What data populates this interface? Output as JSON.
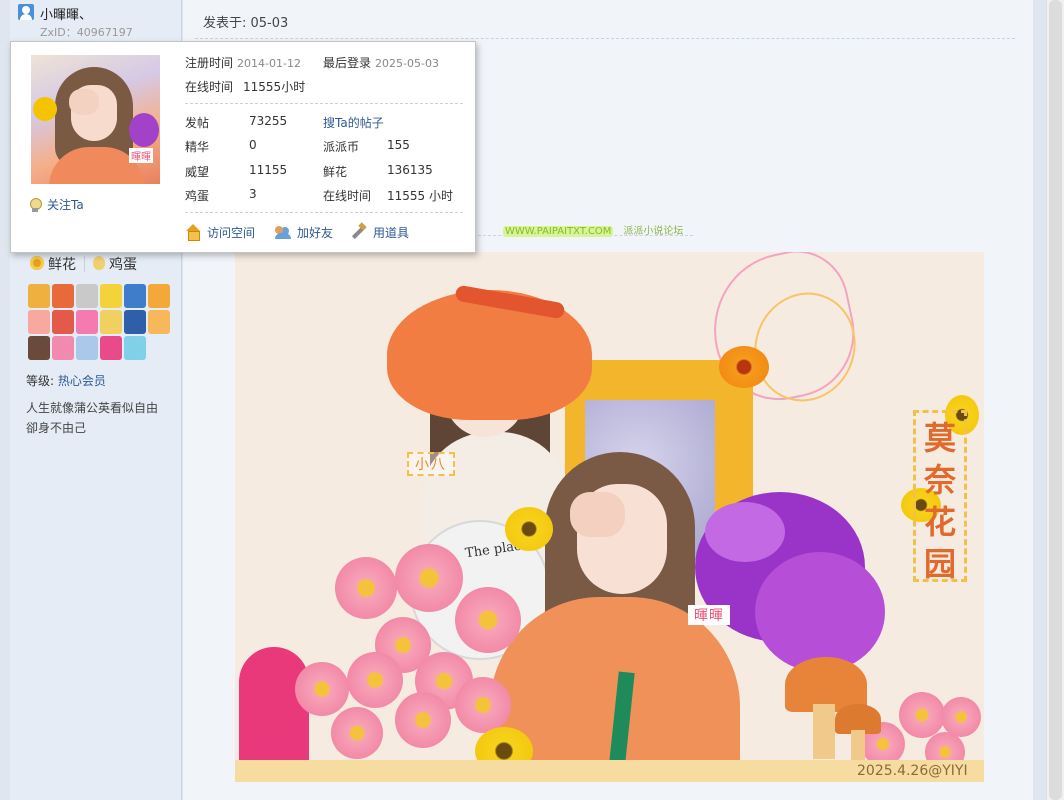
{
  "author": {
    "name": "小暉暉、",
    "zxid": "ZxID：40967197"
  },
  "post": {
    "date": "发表于: 05-03"
  },
  "card": {
    "follow_label": "关注Ta",
    "reg_label": "注册时间",
    "reg_value": "2014-01-12",
    "last_login_label": "最后登录",
    "last_login_value": "2025-05-03",
    "online_label": "在线时间",
    "online_value": "11555小时",
    "stats": {
      "posts_label": "发帖",
      "posts_value": "73255",
      "search_link": "搜Ta的帖子",
      "digest_label": "精华",
      "digest_value": "0",
      "coins_label": "派派币",
      "coins_value": "155",
      "prestige_label": "威望",
      "prestige_value": "11155",
      "flowers_label": "鲜花",
      "flowers_value": "136135",
      "eggs_label": "鸡蛋",
      "eggs_value": "3",
      "online_label": "在线时间",
      "online_value": "11555 小时"
    },
    "actions": {
      "visit": "访问空间",
      "add_friend": "加好友",
      "use_tool": "用道具"
    }
  },
  "sidebar": {
    "flower_label": "鲜花",
    "egg_label": "鸡蛋",
    "level_label": "等级: ",
    "level_value": "热心会员",
    "signature": "人生就像蒲公英看似自由卻身不由己"
  },
  "watermark": {
    "url": "WWW.PAIPAITXT.COM",
    "forum": "派派小说论坛"
  },
  "image": {
    "tag_left": "小八",
    "tag_right": "暉暉",
    "title_chars": [
      "莫",
      "奈",
      "花",
      "园"
    ],
    "record_text": "The place",
    "signature": "2025.4.26@YIYI"
  },
  "colors": {
    "link": "#2d5a91",
    "sidebar_bg": "#e5ecf5",
    "main_bg": "#f1f5fa"
  }
}
